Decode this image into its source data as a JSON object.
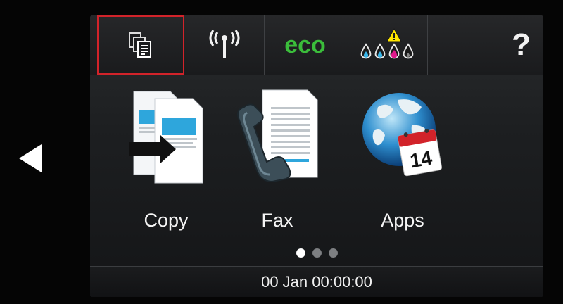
{
  "topbar": {
    "items": [
      {
        "icon": "copy-documents-icon"
      },
      {
        "icon": "wireless-signal-icon"
      },
      {
        "label": "eco",
        "color": "#3bbd3b"
      },
      {
        "icon": "ink-levels-warning-icon",
        "ink_colors": [
          "#38b5e8",
          "#e0198c",
          "#ffe600",
          "#0a0a0a"
        ]
      },
      {
        "label": "?"
      }
    ]
  },
  "tiles": [
    {
      "label": "Copy",
      "icon": "copy-icon"
    },
    {
      "label": "Fax",
      "icon": "fax-icon"
    },
    {
      "label": "Apps",
      "icon": "apps-globe-calendar-icon",
      "calendar_day": "14"
    }
  ],
  "pagination": {
    "pages": 3,
    "current": 1
  },
  "status": {
    "datetime": "00 Jan 00:00:00"
  },
  "colors": {
    "selection": "#d2232a",
    "accent_blue": "#29a8e0"
  }
}
